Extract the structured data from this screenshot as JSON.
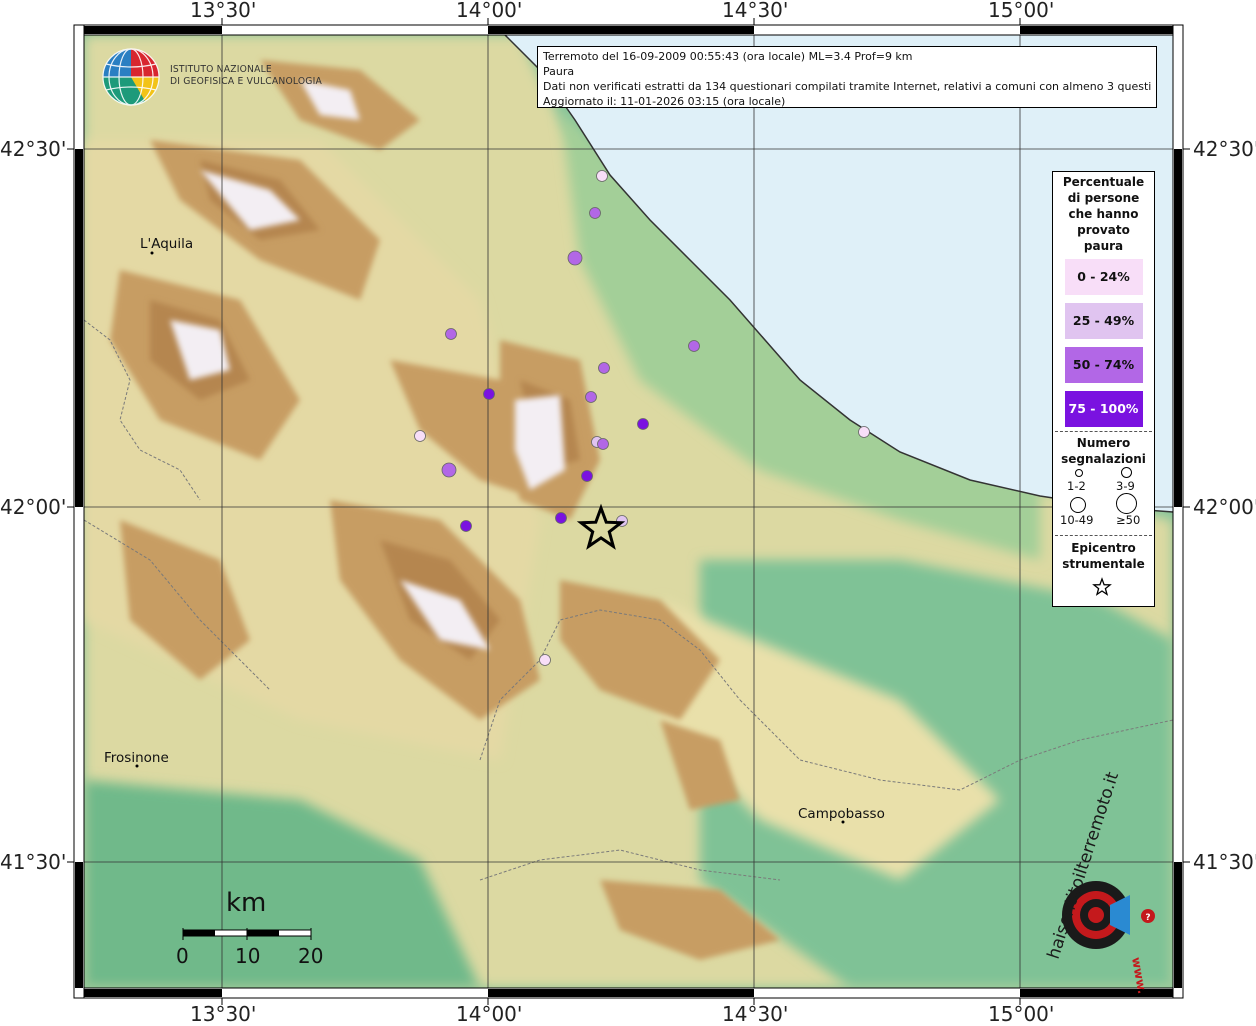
{
  "map": {
    "title_line1": "Terremoto del 16-09-2009 00:55:43 (ora locale) ML=3.4 Prof=9 km",
    "title_line2": "Paura",
    "title_line3": "Dati non verificati estratti da 134 questionari compilati tramite Internet, relativi a comuni con almeno 3 questionari.",
    "title_line4": "Aggiornato il: 11-01-2026 03:15 (ora locale)",
    "logo": {
      "line1": "ISTITUTO NAZIONALE",
      "line2": "DI GEOFISICA E VULCANOLOGIA"
    },
    "brand_logo_text": "haisentitoilterremoto.it",
    "brand_logo_alt": "www.",
    "lon_ticks": [
      "13°30'",
      "14°00'",
      "14°30'",
      "15°00'"
    ],
    "lat_ticks": [
      "42°30'",
      "42°00'",
      "41°30'"
    ],
    "cities": [
      {
        "name": "L'Aquila"
      },
      {
        "name": "Frosinone"
      },
      {
        "name": "Campobasso"
      }
    ],
    "scale_bar": {
      "unit": "km",
      "labels": [
        "0",
        "10",
        "20"
      ]
    },
    "legend": {
      "title": [
        "Percentuale",
        "di persone",
        "che hanno",
        "provato",
        "paura"
      ],
      "classes": [
        {
          "label": "0 - 24%",
          "color": "#f8def8",
          "text_color": "#111111"
        },
        {
          "label": "25 - 49%",
          "color": "#e0c4f0",
          "text_color": "#111111"
        },
        {
          "label": "50 - 74%",
          "color": "#b267e6",
          "text_color": "#111111"
        },
        {
          "label": "75 - 100%",
          "color": "#7a12e0",
          "text_color": "#ffffff"
        }
      ],
      "count_title": [
        "Numero",
        "segnalazioni"
      ],
      "sizes": [
        "1-2",
        "3-9",
        "10-49",
        "≥50"
      ],
      "epicenter_title": [
        "Epicentro",
        "strumentale"
      ]
    },
    "colors": {
      "sea": "#dff0f8",
      "lowland": "#7fc096",
      "hills": "#e6dca8",
      "mountains": "#c89a5c",
      "peaks": "#f4eef4"
    },
    "observations": [
      {
        "class": 0,
        "size": "3-9"
      },
      {
        "class": 2,
        "size": "3-9"
      },
      {
        "class": 2,
        "size": "10-49"
      },
      {
        "class": 2,
        "size": "3-9"
      },
      {
        "class": 2,
        "size": "3-9"
      },
      {
        "class": 2,
        "size": "3-9"
      },
      {
        "class": 3,
        "size": "3-9"
      },
      {
        "class": 2,
        "size": "3-9"
      },
      {
        "class": 3,
        "size": "3-9"
      },
      {
        "class": 0,
        "size": "3-9"
      },
      {
        "class": 1,
        "size": "3-9"
      },
      {
        "class": 2,
        "size": "3-9"
      },
      {
        "class": 2,
        "size": "10-49"
      },
      {
        "class": 3,
        "size": "3-9"
      },
      {
        "class": 0,
        "size": "3-9"
      },
      {
        "class": 3,
        "size": "3-9"
      },
      {
        "class": 3,
        "size": "3-9"
      },
      {
        "class": 1,
        "size": "3-9"
      },
      {
        "class": 0,
        "size": "3-9"
      }
    ]
  }
}
